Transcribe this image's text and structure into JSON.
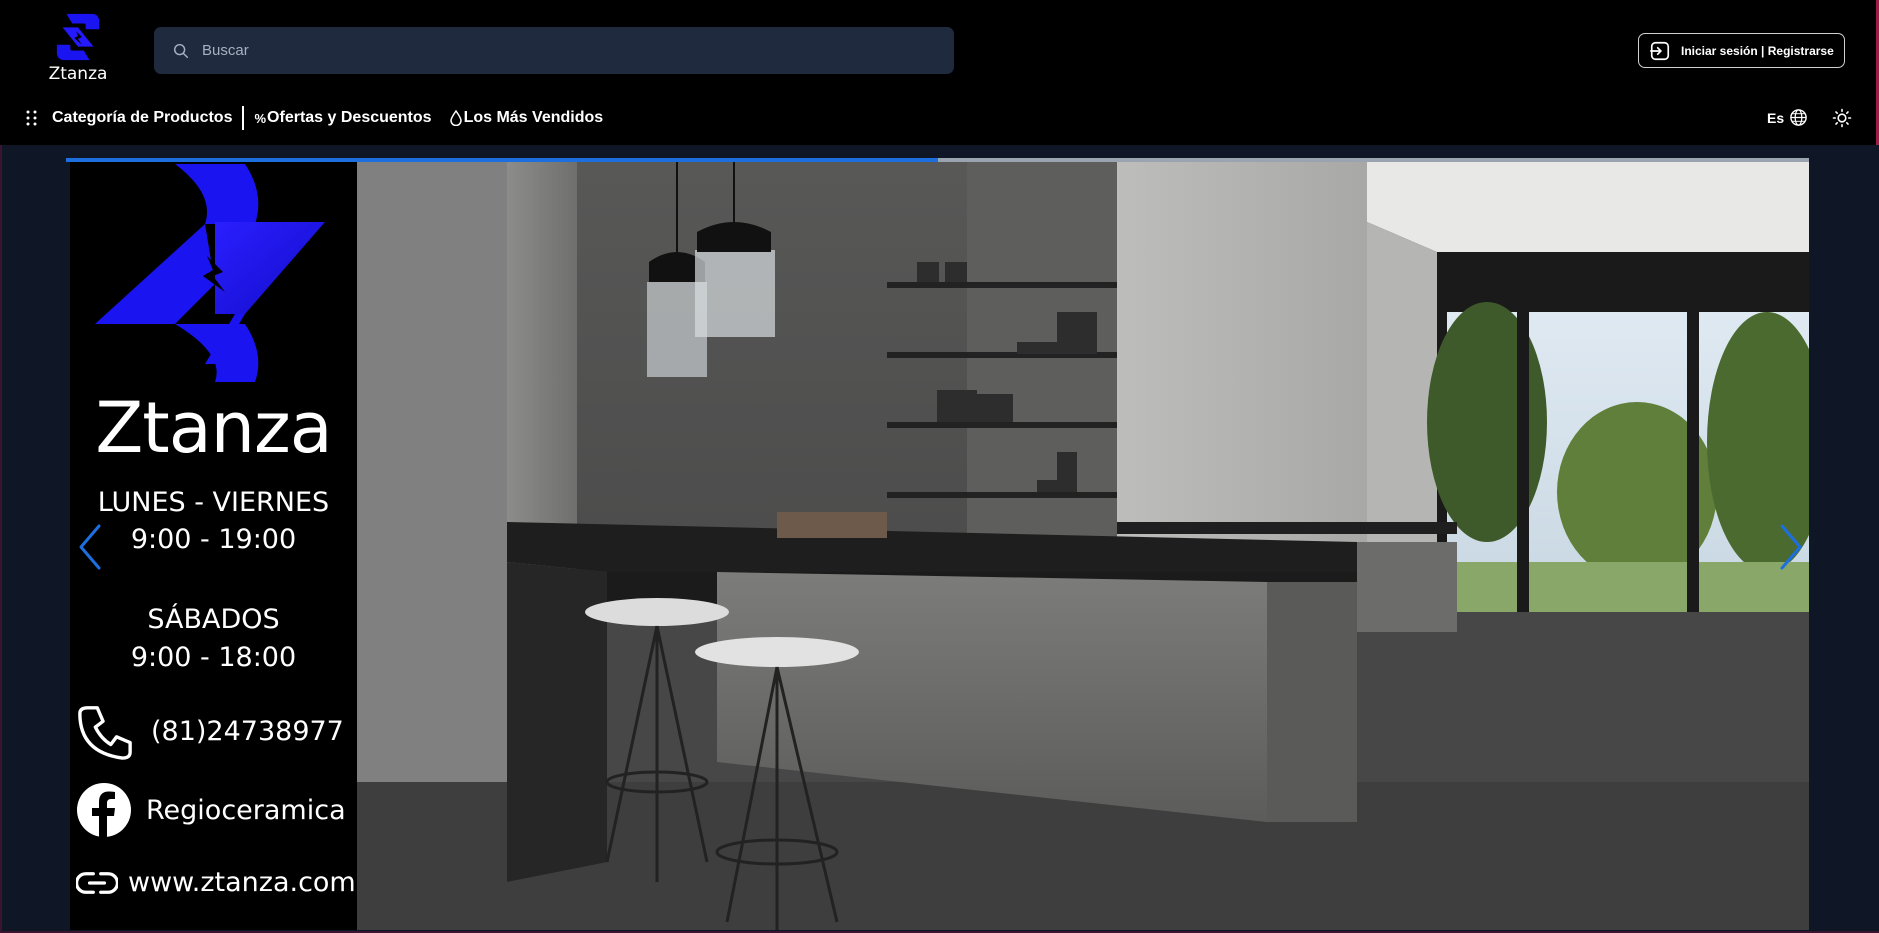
{
  "brand": {
    "name": "Ztanza"
  },
  "search": {
    "placeholder": "Buscar"
  },
  "auth": {
    "label": "Iniciar sesión | Registrarse"
  },
  "nav": {
    "items": [
      {
        "label": "Categoría de Productos"
      },
      {
        "label": "Ofertas y Descuentos"
      },
      {
        "label": "Los Más Vendidos"
      }
    ]
  },
  "language": {
    "code": "Es"
  },
  "carousel": {
    "progress": 0.5,
    "promo": {
      "brand": "Ztanza",
      "weekdays_title": "LUNES - VIERNES",
      "weekdays_hours": "9:00 - 19:00",
      "saturday_title": "SÁBADOS",
      "saturday_hours": "9:00 - 18:00",
      "phone": "(81)24738977",
      "facebook": "Regioceramica",
      "website": "www.ztanza.com"
    }
  },
  "colors": {
    "accent": "#1d6fe0",
    "brand_blue": "#1a14f0",
    "header_bg": "#000000",
    "page_bg": "#0f1626",
    "search_bg": "#1f2a3f"
  },
  "icons": {
    "logo": "ztanza-logo-icon",
    "search": "search-icon",
    "login": "login-icon",
    "categories": "grid-dots-icon",
    "offers": "percent-icon",
    "bestsellers": "drop-icon",
    "language": "globe-icon",
    "theme": "sun-icon",
    "prev": "chevron-left-icon",
    "next": "chevron-right-icon",
    "phone": "phone-icon",
    "facebook": "facebook-icon",
    "website": "link-icon"
  }
}
